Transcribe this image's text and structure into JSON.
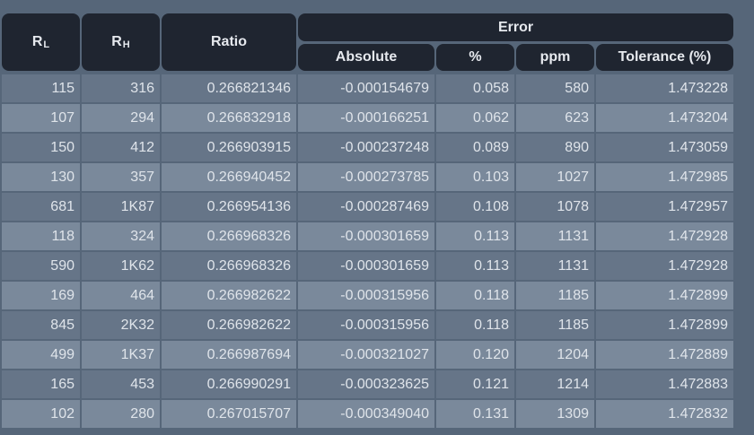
{
  "headers": {
    "rl": {
      "base": "R",
      "sub": "L"
    },
    "rh": {
      "base": "R",
      "sub": "H"
    },
    "ratio": "Ratio",
    "error": "Error",
    "absolute": "Absolute",
    "percent": "%",
    "ppm": "ppm",
    "tolerance": "Tolerance (%)"
  },
  "rows": [
    [
      "115",
      "316",
      "0.266821346",
      "-0.000154679",
      "0.058",
      "580",
      "1.473228"
    ],
    [
      "107",
      "294",
      "0.266832918",
      "-0.000166251",
      "0.062",
      "623",
      "1.473204"
    ],
    [
      "150",
      "412",
      "0.266903915",
      "-0.000237248",
      "0.089",
      "890",
      "1.473059"
    ],
    [
      "130",
      "357",
      "0.266940452",
      "-0.000273785",
      "0.103",
      "1027",
      "1.472985"
    ],
    [
      "681",
      "1K87",
      "0.266954136",
      "-0.000287469",
      "0.108",
      "1078",
      "1.472957"
    ],
    [
      "118",
      "324",
      "0.266968326",
      "-0.000301659",
      "0.113",
      "1131",
      "1.472928"
    ],
    [
      "590",
      "1K62",
      "0.266968326",
      "-0.000301659",
      "0.113",
      "1131",
      "1.472928"
    ],
    [
      "169",
      "464",
      "0.266982622",
      "-0.000315956",
      "0.118",
      "1185",
      "1.472899"
    ],
    [
      "845",
      "2K32",
      "0.266982622",
      "-0.000315956",
      "0.118",
      "1185",
      "1.472899"
    ],
    [
      "499",
      "1K37",
      "0.266987694",
      "-0.000321027",
      "0.120",
      "1204",
      "1.472889"
    ],
    [
      "165",
      "453",
      "0.266990291",
      "-0.000323625",
      "0.121",
      "1214",
      "1.472883"
    ],
    [
      "102",
      "280",
      "0.267015707",
      "-0.000349040",
      "0.131",
      "1309",
      "1.472832"
    ]
  ]
}
